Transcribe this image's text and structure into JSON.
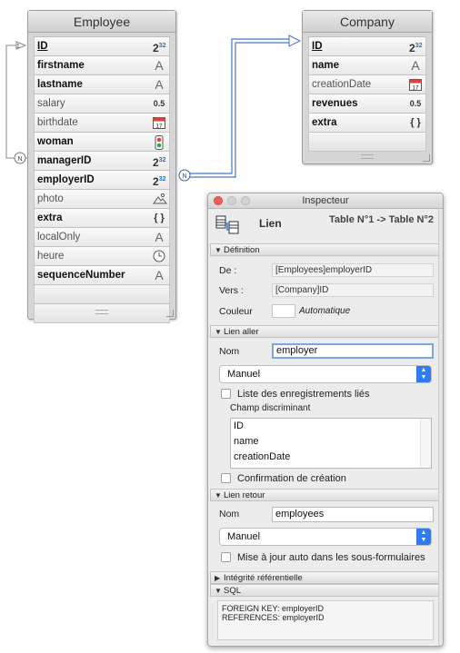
{
  "employee_table": {
    "title": "Employee",
    "fields": [
      {
        "name": "ID",
        "icon": "integer32-icon",
        "glyph": "2",
        "glyph_sup": "32",
        "style": "bold key"
      },
      {
        "name": "firstname",
        "icon": "alpha-icon",
        "glyph": "A",
        "style": "bold"
      },
      {
        "name": "lastname",
        "icon": "alpha-icon",
        "glyph": "A",
        "style": "bold"
      },
      {
        "name": "salary",
        "icon": "real-icon",
        "glyph": "0.5",
        "style": "light"
      },
      {
        "name": "birthdate",
        "icon": "date-icon",
        "glyph": "17",
        "style": "light"
      },
      {
        "name": "woman",
        "icon": "boolean-icon",
        "glyph": "",
        "style": "bold"
      },
      {
        "name": "managerID",
        "icon": "integer32-icon",
        "glyph": "2",
        "glyph_sup": "32",
        "style": "bold"
      },
      {
        "name": "employerID",
        "icon": "integer32-icon",
        "glyph": "2",
        "glyph_sup": "32",
        "style": "bold"
      },
      {
        "name": "photo",
        "icon": "picture-icon",
        "glyph": "",
        "style": "light"
      },
      {
        "name": "extra",
        "icon": "object-icon",
        "glyph": "{ }",
        "style": "bold"
      },
      {
        "name": "localOnly",
        "icon": "alpha-icon",
        "glyph": "A",
        "style": "light"
      },
      {
        "name": "heure",
        "icon": "time-icon",
        "glyph": "",
        "style": "light"
      },
      {
        "name": "sequenceNumber",
        "icon": "alpha-icon",
        "glyph": "A",
        "style": "bold"
      }
    ]
  },
  "company_table": {
    "title": "Company",
    "fields": [
      {
        "name": "ID",
        "icon": "integer32-icon",
        "glyph": "2",
        "glyph_sup": "32",
        "style": "bold key"
      },
      {
        "name": "name",
        "icon": "alpha-icon",
        "glyph": "A",
        "style": "bold"
      },
      {
        "name": "creationDate",
        "icon": "date-icon",
        "glyph": "17",
        "style": "light"
      },
      {
        "name": "revenues",
        "icon": "real-icon",
        "glyph": "0.5",
        "style": "bold"
      },
      {
        "name": "extra",
        "icon": "object-icon",
        "glyph": "{ }",
        "style": "bold"
      }
    ]
  },
  "relation_markers": {
    "many": "N",
    "one": "1"
  },
  "inspector": {
    "window_title": "Inspecteur",
    "object_type": "Lien",
    "tables_line": "Table N°1 -> Table N°2",
    "definition": {
      "section": "Définition",
      "from_label": "De :",
      "from_value": "[Employees]employerID",
      "to_label": "Vers :",
      "to_value": "[Company]ID",
      "color_label": "Couleur",
      "color_value": "Automatique"
    },
    "forward": {
      "section": "Lien aller",
      "name_label": "Nom",
      "name_value": "employer",
      "mode_value": "Manuel",
      "related_list_label": "Liste des enregistrements liés",
      "discriminant_label": "Champ discriminant",
      "discriminant_options": [
        "ID",
        "name",
        "creationDate"
      ],
      "confirm_label": "Confirmation de création"
    },
    "backward": {
      "section": "Lien retour",
      "name_label": "Nom",
      "name_value": "employees",
      "mode_value": "Manuel",
      "auto_update_label": "Mise à jour auto dans les sous-formulaires"
    },
    "integrity": {
      "section": "Intégrité référentielle"
    },
    "sql": {
      "section": "SQL",
      "line1": "FOREIGN KEY: employerID",
      "line2": "REFERENCES: employerID"
    }
  },
  "colors": {
    "link_line": "#4a78c8",
    "accent_blue": "#2f7bf5",
    "focus_ring": "#7aa7e0"
  }
}
